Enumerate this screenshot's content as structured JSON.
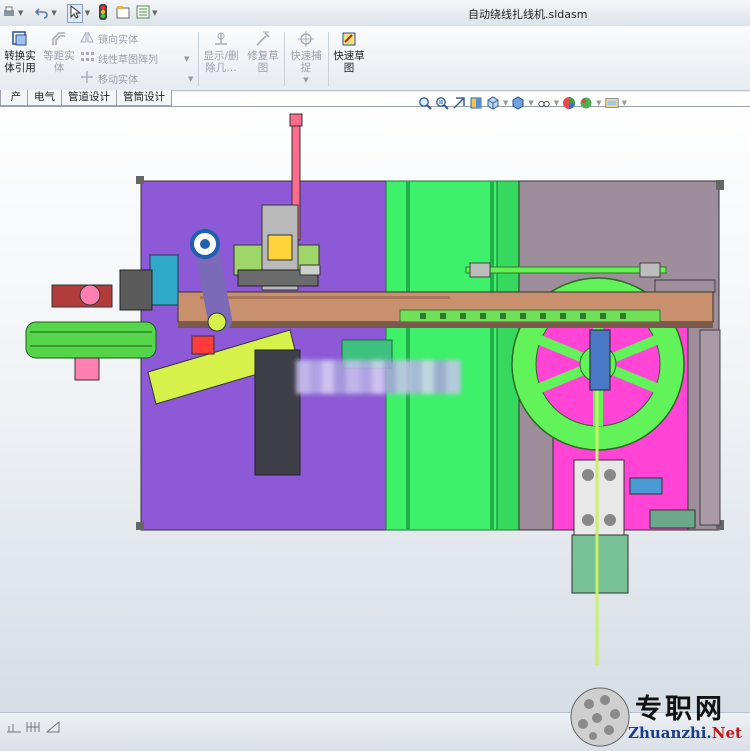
{
  "window": {
    "title": "自动绕线扎线机.sldasm"
  },
  "quick_access": {
    "icons": [
      "print-icon",
      "undo-icon",
      "select-icon",
      "rebuild-icon",
      "file-properties-icon",
      "options-icon"
    ]
  },
  "ribbon": {
    "convert_entities": "转换实\n体引用",
    "offset_entities": "等距实\n体",
    "mirror_entities": "镜向实体",
    "linear_pattern": "线性草图阵列",
    "move_entities": "移动实体",
    "show_delete": "显示/删\n除几…",
    "repair_sketch": "修复草\n图",
    "quick_snaps": "快速捕\n捉",
    "rapid_sketch": "快速草\n图"
  },
  "tabs": [
    "产品",
    "电气",
    "管道设计",
    "管筒设计"
  ],
  "heads_up_toolbar": {
    "icons": [
      "zoom-to-fit-icon",
      "zoom-area-icon",
      "previous-view-icon",
      "section-view-icon",
      "view-orientation-icon",
      "display-style-icon",
      "hide-show-icon",
      "appearance-icon",
      "scene-icon",
      "view-settings-icon"
    ]
  },
  "status_bar": {
    "icons": [
      "sketch-status-icon",
      "grid-icon",
      "measure-icon"
    ]
  },
  "watermark": {
    "brand_cn": "专职网",
    "brand_en_part1": "Zhuanzhi.",
    "brand_en_part2": "Net"
  },
  "colors": {
    "base_purple": "#8d59d6",
    "rail_green": "#3ef06a",
    "plate_gray": "#9e8d9a",
    "magenta_block": "#ff44d6",
    "wheel_green": "#62f25a",
    "beam_tan": "#c9906e",
    "yellow_green": "#d6f24a",
    "pink_rod": "#ff6b8a"
  }
}
